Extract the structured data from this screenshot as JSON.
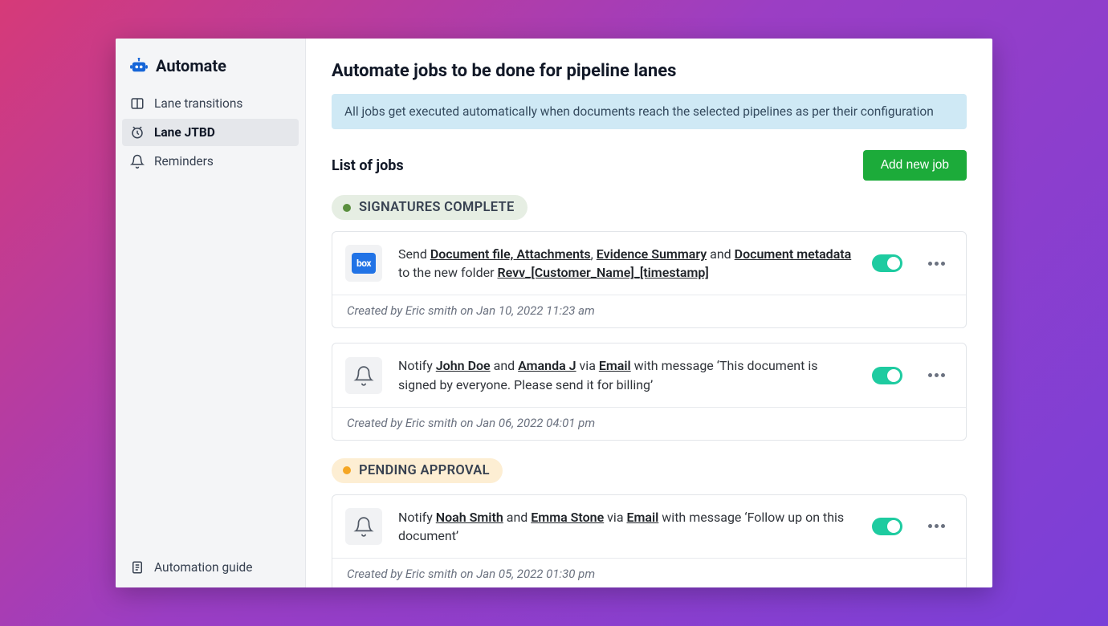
{
  "sidebar": {
    "title": "Automate",
    "items": [
      {
        "label": "Lane transitions"
      },
      {
        "label": "Lane JTBD"
      },
      {
        "label": "Reminders"
      }
    ],
    "guide_label": "Automation guide"
  },
  "main": {
    "title": "Automate jobs to be done for pipeline lanes",
    "banner": "All jobs get executed automatically when documents reach the selected pipelines as per their configuration",
    "list_title": "List of jobs",
    "add_button": "Add new job",
    "groups": [
      {
        "label": "SIGNATURES COMPLETE",
        "color": "green",
        "jobs": [
          {
            "icon": "box",
            "pre": "Send ",
            "link1": "Document file, Attachments",
            "sep1": ", ",
            "link2": "Evidence Summary",
            "mid1": " and ",
            "link3": "Document metadata",
            "mid2": " to the new folder ",
            "link4": "Revv_[Customer_Name]_[timestamp]",
            "meta": "Created by Eric smith on Jan 10, 2022 11:23 am"
          },
          {
            "icon": "bell",
            "pre": "Notify ",
            "link1": "John Doe",
            "mid1": " and ",
            "link2": "Amanda J",
            "mid2": " via ",
            "link3": "Email",
            "post": " with message ‘This document is signed by everyone. Please send it for billing’",
            "meta": "Created by Eric smith on Jan 06, 2022 04:01 pm"
          }
        ]
      },
      {
        "label": "PENDING APPROVAL",
        "color": "orange",
        "jobs": [
          {
            "icon": "bell",
            "pre": "Notify ",
            "link1": "Noah Smith",
            "mid1": " and ",
            "link2": "Emma Stone",
            "mid2": " via ",
            "link3": "Email",
            "post": " with message ‘Follow up on this document’",
            "meta": "Created by Eric smith on Jan 05, 2022 01:30 pm"
          }
        ]
      }
    ]
  }
}
